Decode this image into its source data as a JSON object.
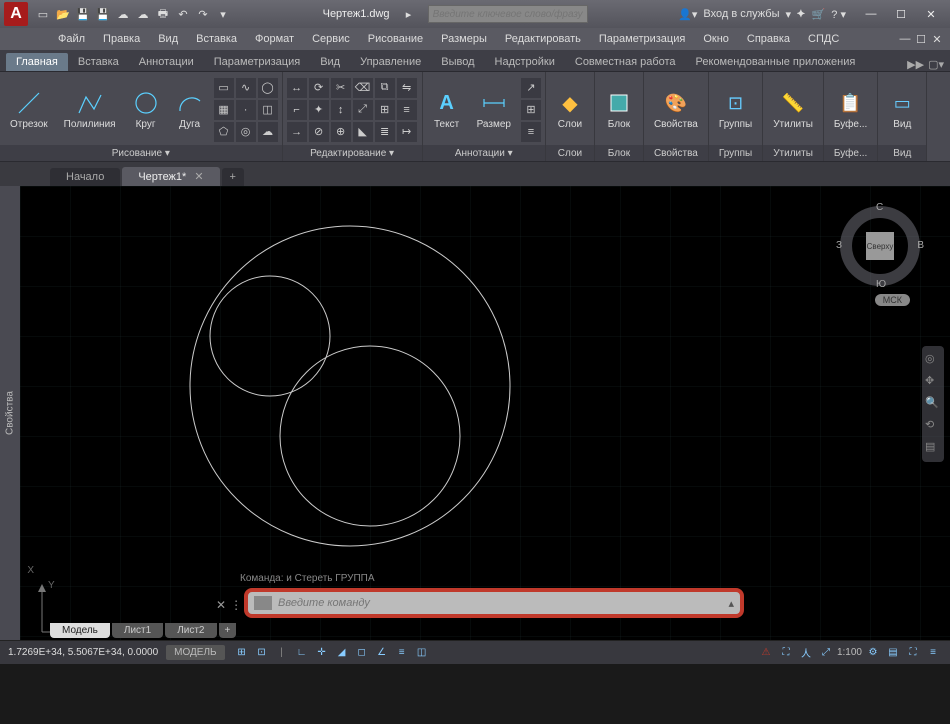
{
  "title": "Чертеж1.dwg",
  "search_placeholder": "Введите ключевое слово/фразу",
  "login_label": "Вход в службы",
  "menus": [
    "Файл",
    "Правка",
    "Вид",
    "Вставка",
    "Формат",
    "Сервис",
    "Рисование",
    "Размеры",
    "Редактировать",
    "Параметризация",
    "Окно",
    "Справка",
    "СПДС"
  ],
  "ribbon_tabs": [
    "Главная",
    "Вставка",
    "Аннотации",
    "Параметризация",
    "Вид",
    "Управление",
    "Вывод",
    "Надстройки",
    "Совместная работа",
    "Рекомендованные приложения"
  ],
  "ribbon_extra": "▶▶",
  "panels": {
    "draw": {
      "title": "Рисование ▾",
      "line": "Отрезок",
      "polyline": "Полилиния",
      "circle": "Круг",
      "arc": "Дуга"
    },
    "modify": {
      "title": "Редактирование ▾"
    },
    "annot": {
      "title": "Аннотации ▾",
      "text": "Текст",
      "dim": "Размер"
    },
    "layers": {
      "title": "Слои",
      "btn": "Слои"
    },
    "block": {
      "title": "Блок",
      "btn": "Блок"
    },
    "props": {
      "title": "Свойства",
      "btn": "Свойства"
    },
    "groups": {
      "title": "Группы",
      "btn": "Группы"
    },
    "utils": {
      "title": "Утилиты",
      "btn": "Утилиты"
    },
    "clip": {
      "title": "Буфе...",
      "btn": "Буфе..."
    },
    "view": {
      "title": "Вид",
      "btn": "Вид"
    }
  },
  "filetabs": {
    "start": "Начало",
    "active": "Чертеж1*"
  },
  "palette_label": "Свойства",
  "viewcube": {
    "top": "Сверху",
    "n": "С",
    "s": "Ю",
    "e": "В",
    "w": "З"
  },
  "wcs": "МСК",
  "ucs": {
    "x": "X",
    "y": "Y"
  },
  "cmd_history": "Команда:   и Стереть ГРУППА",
  "cmd_placeholder": "Введите команду",
  "layout_tabs": [
    "Модель",
    "Лист1",
    "Лист2"
  ],
  "status": {
    "coords": "1.7269E+34, 5.5067E+34, 0.0000",
    "model": "МОДЕЛЬ",
    "scale": "1:100"
  }
}
